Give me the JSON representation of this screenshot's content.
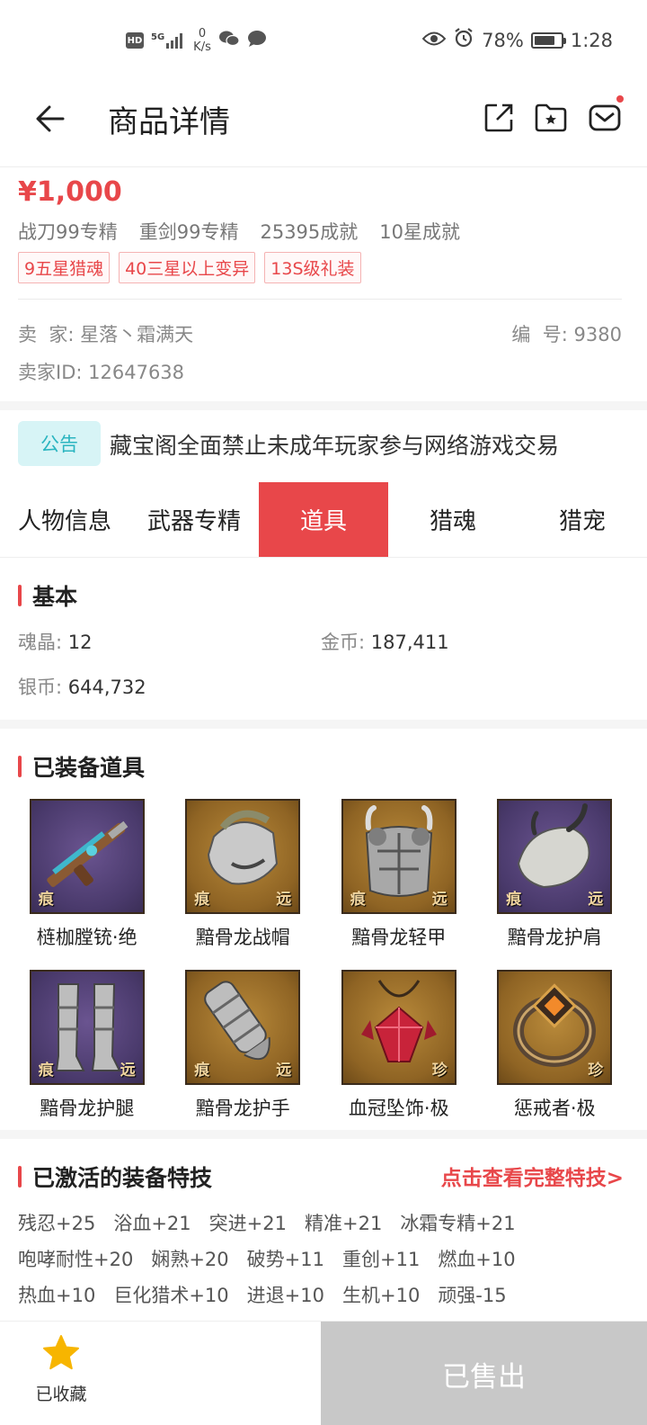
{
  "status_bar": {
    "hd": "HD",
    "signal": "5G",
    "speed_value": "0",
    "speed_unit": "K/s",
    "battery": "78%",
    "battery_level": 0.78,
    "time": "1:28"
  },
  "header": {
    "title": "商品详情"
  },
  "product": {
    "price": "¥1,000",
    "subtitles": [
      "战刀99专精",
      "重剑99专精",
      "25395成就",
      "10星成就"
    ],
    "tags": [
      "9五星猎魂",
      "40三星以上变异",
      "13S级礼装"
    ],
    "seller_label": "卖  家:",
    "seller_name": "星落丶霜满天",
    "number_label": "编  号:",
    "number": "9380",
    "seller_id_label": "卖家ID:",
    "seller_id": "12647638"
  },
  "notice": {
    "badge": "公告",
    "text": "藏宝阁全面禁止未成年玩家参与网络游戏交易"
  },
  "tabs": [
    {
      "label": "人物信息",
      "active": false
    },
    {
      "label": "武器专精",
      "active": false
    },
    {
      "label": "道具",
      "active": true
    },
    {
      "label": "猎魂",
      "active": false
    },
    {
      "label": "猎宠",
      "active": false
    }
  ],
  "basic": {
    "title": "基本",
    "soul_label": "魂晶:",
    "soul_value": "12",
    "gold_label": "金币:",
    "gold_value": "187,411",
    "silver_label": "银币:",
    "silver_value": "644,732"
  },
  "equipped": {
    "title": "已装备道具",
    "items": [
      {
        "name": "梿枷膛铳·绝",
        "icon": "gun-icon",
        "bg": "purple",
        "mark_left": "痕",
        "mark_right": ""
      },
      {
        "name": "黯骨龙战帽",
        "icon": "helmet-icon",
        "bg": "gold",
        "mark_left": "痕",
        "mark_right": "远"
      },
      {
        "name": "黯骨龙轻甲",
        "icon": "armor-icon",
        "bg": "gold",
        "mark_left": "痕",
        "mark_right": "远"
      },
      {
        "name": "黯骨龙护肩",
        "icon": "shoulder-icon",
        "bg": "purple",
        "mark_left": "痕",
        "mark_right": "远"
      },
      {
        "name": "黯骨龙护腿",
        "icon": "greaves-icon",
        "bg": "purple",
        "mark_left": "痕",
        "mark_right": "远"
      },
      {
        "name": "黯骨龙护手",
        "icon": "gauntlet-icon",
        "bg": "gold",
        "mark_left": "痕",
        "mark_right": "远"
      },
      {
        "name": "血冠坠饰·极",
        "icon": "pendant-icon",
        "bg": "gold",
        "mark_left": "",
        "mark_right": "珍"
      },
      {
        "name": "惩戒者·极",
        "icon": "ring-icon",
        "bg": "gold",
        "mark_left": "",
        "mark_right": "珍"
      }
    ]
  },
  "skills": {
    "title": "已激活的装备特技",
    "link": "点击查看完整特技>",
    "rows": [
      [
        "残忍+25",
        "浴血+21",
        "突进+21",
        "精准+21",
        "冰霜专精+21"
      ],
      [
        "咆哮耐性+20",
        "娴熟+20",
        "破势+11",
        "重创+11",
        "燃血+10"
      ],
      [
        "热血+10",
        "巨化猎术+10",
        "进退+10",
        "生机+10",
        "顽强-15"
      ]
    ]
  },
  "bottom": {
    "fav_label": "已收藏",
    "sold_label": "已售出"
  },
  "colors": {
    "accent": "#e8474a",
    "notice_bg": "#d7f4f6",
    "notice_fg": "#2bb5c0",
    "sold_bg": "#c8c8c8",
    "star": "#f7b500"
  }
}
